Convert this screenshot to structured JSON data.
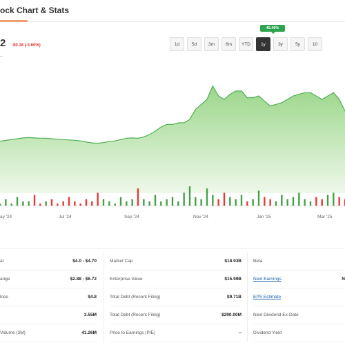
{
  "header": {
    "title": "ock Chart & Stats"
  },
  "quote": {
    "price": "2",
    "change": "-$0.18 (-3.60%)",
    "subnote": "..."
  },
  "ranges": {
    "perf_badge": "45.40%",
    "buttons": [
      {
        "label": "1d",
        "active": false
      },
      {
        "label": "5d",
        "active": false
      },
      {
        "label": "3m",
        "active": false
      },
      {
        "label": "6m",
        "active": false
      },
      {
        "label": "YTD",
        "active": false
      },
      {
        "label": "1y",
        "active": true
      },
      {
        "label": "3y",
        "active": false
      },
      {
        "label": "5y",
        "active": false
      },
      {
        "label": "10",
        "active": false
      }
    ]
  },
  "chart_data": {
    "type": "area",
    "x_tick_labels": [
      "ay '24",
      "Jul '24",
      "Sep '24",
      "Nov '24",
      "Jan '25",
      "Mar '25"
    ],
    "values": [
      3.1,
      3.15,
      3.2,
      3.25,
      3.3,
      3.32,
      3.3,
      3.28,
      3.28,
      3.25,
      3.22,
      3.2,
      3.18,
      3.16,
      3.12,
      3.05,
      3.0,
      2.98,
      3.02,
      3.08,
      3.12,
      3.2,
      3.28,
      3.3,
      3.28,
      3.35,
      3.5,
      3.7,
      3.95,
      4.1,
      4.1,
      4.2,
      4.2,
      4.4,
      5.0,
      5.3,
      5.6,
      6.4,
      5.8,
      5.6,
      5.9,
      6.1,
      6.1,
      5.7,
      5.7,
      5.8,
      5.5,
      5.2,
      5.3,
      5.4,
      5.6,
      5.8,
      5.9,
      6.0,
      6.0,
      5.8,
      5.6,
      5.8,
      6.0,
      5.6,
      4.9
    ],
    "volume": [
      1,
      3,
      1,
      4,
      2,
      2,
      5,
      1,
      2,
      3,
      1,
      2,
      4,
      2,
      1,
      3,
      2,
      6,
      3,
      2,
      1,
      4,
      2,
      3,
      8,
      3,
      2,
      5,
      2,
      3,
      4,
      2,
      6,
      9,
      4,
      3,
      8,
      5,
      3,
      6,
      4,
      3,
      5,
      2,
      3,
      7,
      4,
      3,
      2,
      5,
      3,
      4,
      6,
      3,
      2,
      4,
      3,
      5,
      6,
      4,
      3
    ],
    "colors": {
      "line": "#4caf50",
      "fill_top": "#9bd68a",
      "fill_bottom": "#eef8ea",
      "vol_up": "#43a047",
      "vol_down": "#e53935"
    },
    "grid": false
  },
  "stats": {
    "col1": [
      {
        "label": "ar",
        "value": "$4.0 - $4.70"
      },
      {
        "label": "ange",
        "value": "$2.88 - $6.72"
      },
      {
        "label": "lose",
        "value": "$4.8"
      },
      {
        "label": "",
        "value": "3.55M"
      },
      {
        "label": "Volume (3M)",
        "value": "41.26M"
      }
    ],
    "col2": [
      {
        "label": "Market Cap",
        "value": "$18.93B"
      },
      {
        "label": "Enterprise Value",
        "value": "$15.99B"
      },
      {
        "label": "Total Debt (Recent Filing)",
        "value": "$9.71B"
      },
      {
        "label": "Total Debt (Recent Filing)",
        "value": "$290.00M"
      },
      {
        "label": "Price to Earnings (P/E)",
        "value": "--"
      }
    ],
    "col3": [
      {
        "label": "Beta",
        "value": "",
        "link": false
      },
      {
        "label": "Next Earnings",
        "value": "N",
        "link": true
      },
      {
        "label": "EPS Estimate",
        "value": "",
        "link": true
      },
      {
        "label": "Next Dividend Ex-Date",
        "value": "",
        "link": false
      },
      {
        "label": "Dividend Yield",
        "value": "",
        "link": false
      }
    ]
  }
}
